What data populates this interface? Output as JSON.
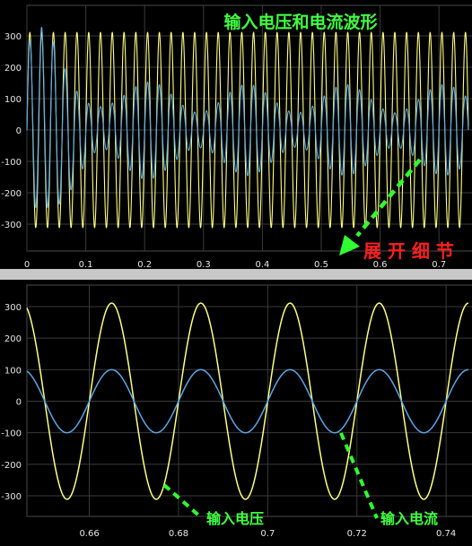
{
  "chart_data": [
    {
      "type": "line",
      "title": "输入电压和电流波形",
      "annotation": "展 开 细 节",
      "xlim": [
        0,
        0.75
      ],
      "ylim": [
        -340,
        340
      ],
      "xticks": [
        0,
        0.1,
        0.2,
        0.3,
        0.4,
        0.5,
        0.6,
        0.7
      ],
      "xtick_labels": [
        "0",
        "0.1",
        "0.2",
        "0.3",
        "0.4",
        "0.5",
        "0.6",
        "0.7"
      ],
      "yticks": [
        300,
        200,
        100,
        0,
        -100,
        -200,
        -300
      ],
      "ytick_labels": [
        "300",
        "200",
        "100",
        "0",
        "-100",
        "-200",
        "-300"
      ],
      "grid": true,
      "series": [
        {
          "role": "voltage",
          "amplitude": 311,
          "frequency_hz": 50,
          "phase_deg": 0,
          "color": "#ffff80"
        },
        {
          "role": "current",
          "steady_amplitude": 100,
          "frequency_hz": 50,
          "transient_peak": 260,
          "transient_end_s": 0.2,
          "color": "#5ba7e6"
        }
      ]
    },
    {
      "type": "line",
      "xlim": [
        0.646,
        0.745
      ],
      "ylim": [
        -360,
        360
      ],
      "xticks": [
        0.66,
        0.68,
        0.7,
        0.72,
        0.74
      ],
      "xtick_labels": [
        "0.66",
        "0.68",
        "0.7",
        "0.72",
        "0.74"
      ],
      "yticks": [
        300,
        200,
        100,
        0,
        -100,
        -200,
        -300
      ],
      "ytick_labels": [
        "300",
        "200",
        "100",
        "0",
        "-100",
        "-200",
        "-300"
      ],
      "grid": true,
      "annotations": [
        "输入电压",
        "输入电流"
      ],
      "series": [
        {
          "role": "voltage",
          "amplitude": 311,
          "frequency_hz": 50,
          "phase_deg": 0,
          "color": "#ffff80"
        },
        {
          "role": "current",
          "amplitude": 100,
          "frequency_hz": 50,
          "phase_deg": 0,
          "color": "#5ba7e6"
        }
      ]
    }
  ],
  "colors": {
    "background": "#000000",
    "frame": "#c8c8c8",
    "grid": "#3a3a3a",
    "tick_text": "#e6e6e6",
    "title": "#40ff40",
    "annotation_red": "#ff2020",
    "arrow": "#30ff30"
  }
}
